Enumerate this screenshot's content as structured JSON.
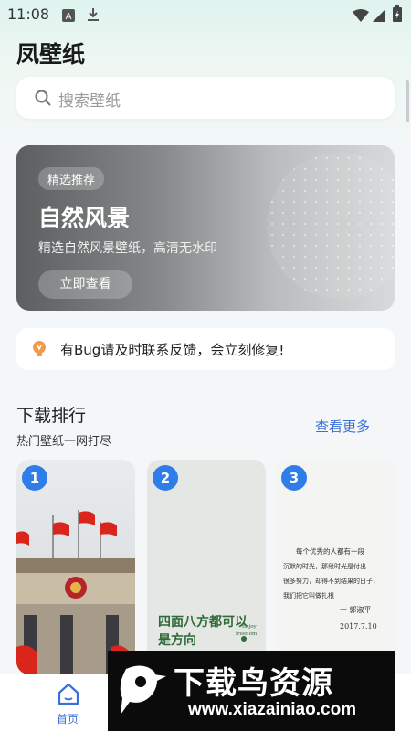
{
  "status_bar": {
    "time": "11:08"
  },
  "app": {
    "title": "凤壁纸"
  },
  "search": {
    "placeholder": "搜索壁纸"
  },
  "banner": {
    "tag": "精选推荐",
    "title": "自然风景",
    "description": "精选自然风景壁纸，高清无水印",
    "button": "立即查看"
  },
  "notice": {
    "text": "有Bug请及时联系反馈，会立刻修复!"
  },
  "ranking": {
    "title": "下载排行",
    "subtitle": "热门壁纸一网打尽",
    "more_label": "查看更多",
    "items": [
      {
        "rank": "1"
      },
      {
        "rank": "2",
        "caption_line1": "四面八方都可以",
        "caption_line2": "是方向",
        "caption_en_line1": "Enjoy",
        "caption_en_line2": "freedom"
      },
      {
        "rank": "3",
        "note_line1": "每个优秀的人都有一段",
        "note_line2": "沉默的时光，那段时光是付出",
        "note_line3": "很多努力，却得不到结果的日子，",
        "note_line4": "我们把它叫做扎根",
        "note_sign": "一 郭淑平",
        "note_date": "2017.7.10"
      }
    ]
  },
  "bottom_nav": {
    "home_label": "首页"
  },
  "watermark": {
    "title": "下载鸟资源",
    "url": "www.xiazainiao.com"
  }
}
